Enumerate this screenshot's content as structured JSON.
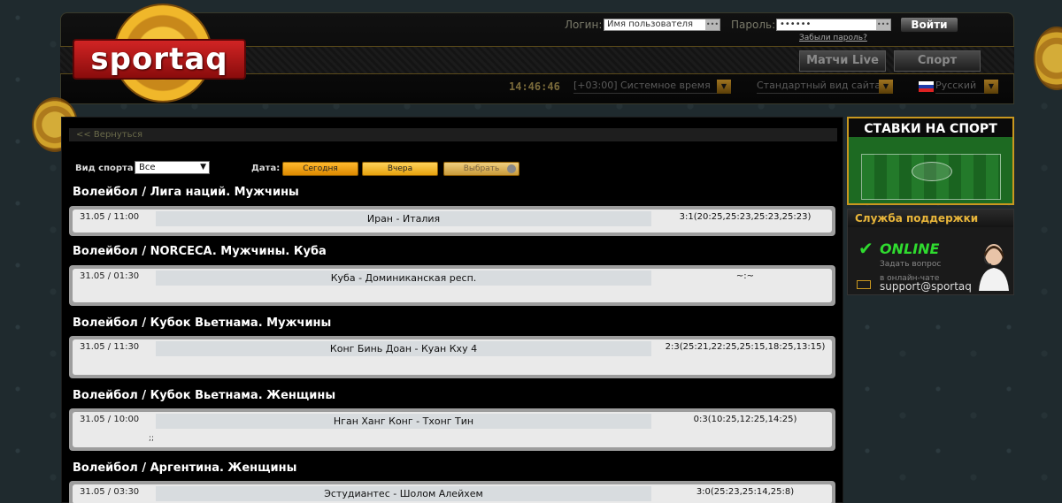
{
  "header": {
    "logo": "sportaq",
    "login_label": "Логин:",
    "login_placeholder": "Имя пользователя",
    "password_label": "Пароль:",
    "password_value": "••••••",
    "input_dots": "•••",
    "login_button": "Войти",
    "forgot_password": "Забыли пароль?",
    "tabs": [
      {
        "label": "Матчи Live"
      },
      {
        "label": "Спорт"
      }
    ],
    "clock": "14:46:46",
    "timezone": "[+03:00] Системное время",
    "view_mode": "Стандартный вид сайта",
    "language": "Русский",
    "arrow_glyph": "▼"
  },
  "main": {
    "back_link": "<< Вернуться",
    "sport_label": "Вид спорта",
    "sport_value": "Все",
    "sport_caret": "▼",
    "date_label": "Дата:",
    "date_buttons": [
      {
        "label": "Сегодня"
      },
      {
        "label": "Вчера"
      },
      {
        "label": "Выбрать"
      }
    ],
    "leagues": [
      {
        "title": "Волейбол / Лига наций. Мужчины",
        "matches": [
          {
            "date": "31.05 / 11:00",
            "teams": "Иран - Италия",
            "score": "3:1(20:25,25:23,25:23,25:23)",
            "extra": ""
          }
        ]
      },
      {
        "title": "Волейбол / NORCECA. Мужчины. Куба",
        "matches": [
          {
            "date": "31.05 / 01:30",
            "teams": "Куба - Доминиканская респ.",
            "score": "~:~",
            "extra": ""
          }
        ]
      },
      {
        "title": "Волейбол / Кубок Вьетнама. Мужчины",
        "matches": [
          {
            "date": "31.05 / 11:30",
            "teams": "Конг Бинь Доан - Куан Кху 4",
            "score": "2:3(25:21,22:25,25:15,18:25,13:15)",
            "extra": ""
          }
        ]
      },
      {
        "title": "Волейбол / Кубок Вьетнама. Женщины",
        "matches": [
          {
            "date": "31.05 / 10:00",
            "teams": "Нган Ханг Конг - Тхонг Тин",
            "score": "0:3(10:25,12:25,14:25)",
            "extra": ";;"
          }
        ]
      },
      {
        "title": "Волейбол / Аргентина. Женщины",
        "matches": [
          {
            "date": "31.05 / 03:30",
            "teams": "Эстудиантес - Шолом Алейхем",
            "score": "3:0(25:23,25:14,25:8)",
            "extra": ""
          }
        ]
      }
    ]
  },
  "sidebar": {
    "banner_title": "СТАВКИ НА СПОРТ",
    "support_title": "Служба поддержки",
    "online_check": "✔",
    "online": "ONLINE",
    "ask": "Задать вопрос",
    "chat": "в онлайн-чате",
    "email": "support@sportaq"
  },
  "colors": {
    "accent_gold": "#e6a20e",
    "online_green": "#2fdb2f",
    "logo_red": "#d12424"
  }
}
